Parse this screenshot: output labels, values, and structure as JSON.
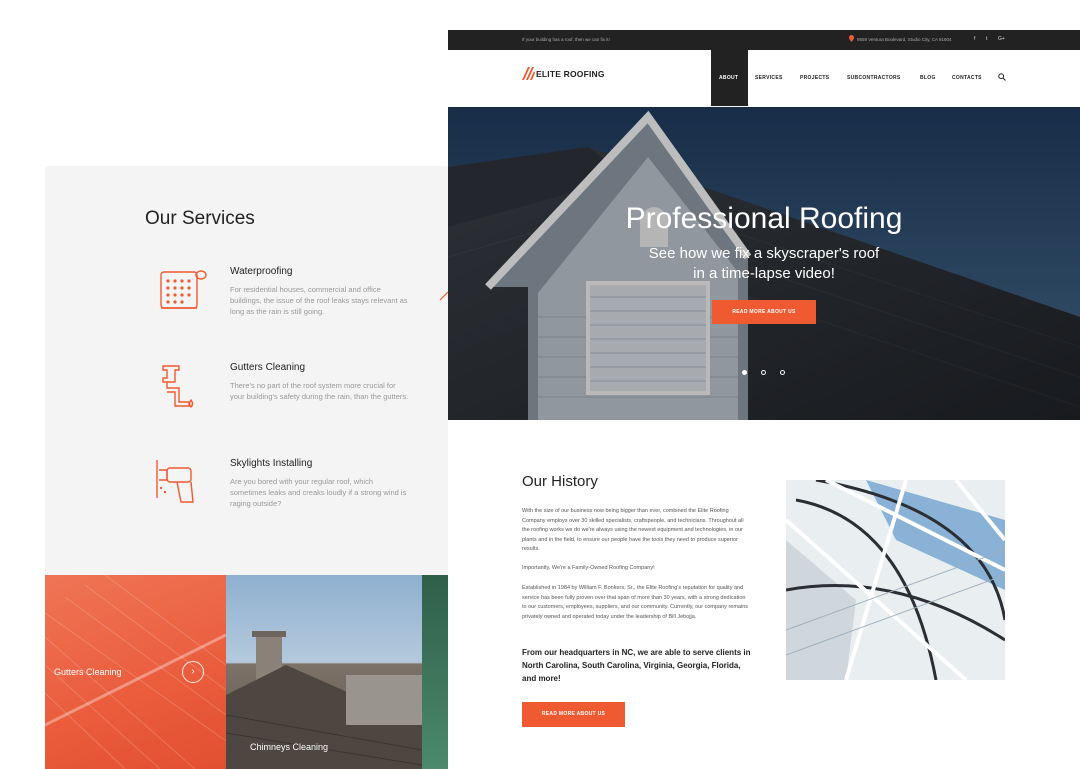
{
  "services": {
    "title": "Our Services",
    "items": [
      {
        "name": "Waterproofing",
        "desc": "For residential houses, commercial and office buildings, the issue of the roof leaks stays relevant as long as the rain is still going.",
        "icon": "waterproofing-icon"
      },
      {
        "name": "Gutters Cleaning",
        "desc": "There's no part of the roof system more crucial for your building's safety during the rain, than the gutters.",
        "icon": "gutter-pipe-icon"
      },
      {
        "name": "Skylights Installing",
        "desc": "Are you bored with your regular roof, which sometimes leaks and creaks loudly if a strong wind is raging outside?",
        "icon": "drill-icon"
      }
    ]
  },
  "tiles": [
    {
      "label": "Gutters Cleaning",
      "arrow": "›"
    },
    {
      "label": "Chimneys Cleaning"
    }
  ],
  "topbar": {
    "tagline": "If your building has a roof, then we can fix it!",
    "address": "9559 Ventura Boulevard, Studio City, CA 91604",
    "social": [
      "f",
      "t",
      "G+"
    ]
  },
  "logo": {
    "text": "ELITE ROOFING"
  },
  "nav": {
    "items": [
      "ABOUT",
      "SERVICES",
      "PROJECTS",
      "SUBCONTRACTORS",
      "BLOG",
      "CONTACTS"
    ],
    "active": "ABOUT"
  },
  "hero": {
    "title": "Professional Roofing",
    "subtitle_line1": "See how we fix a skyscraper's roof",
    "subtitle_line2": "in a time-lapse video!",
    "button": "READ MORE ABOUT US",
    "slides": 3,
    "active_slide": 1
  },
  "history": {
    "title": "Our History",
    "p1": "With the size of our business now being bigger than ever, combined the Elite Roofing Company employs over 30 skilled specialists, craftspeople, and technicians. Throughout all the roofing works we do we're always using the newest equipment and technologies, in our plants and in the field, to ensure our people have the tools they need to produce superior results.",
    "p2": "Importantly, We're a Family-Owned Roofing Company!",
    "p3": "Established in 1984 by William F. Bonkers, Sr., the Elite Roofing's reputation for quality and service has been fully proven over that span of more than 30 years, with a strong dedication to our customers, employees, suppliers, and our community. Currently, our company remains privately owned and operated today under the leadership of Bill Jebojja.",
    "highlight": "From our headquarters in NC, we are able to serve clients in North Carolina, South Carolina, Virginia, Georgia, Florida, and more!",
    "button": "READ MORE ABOUT US"
  },
  "colors": {
    "accent": "#f05a32",
    "dark": "#222222",
    "muted": "#999999"
  }
}
